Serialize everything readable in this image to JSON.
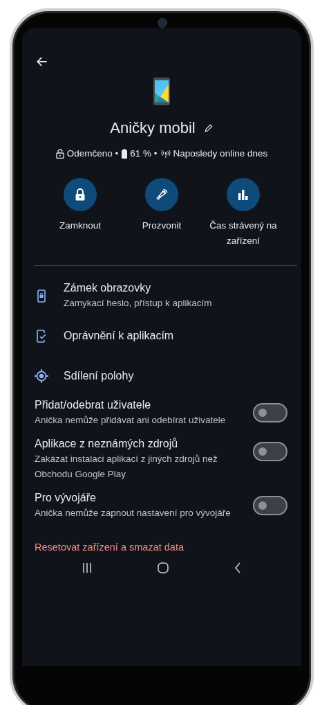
{
  "header": {
    "title": "Aničky mobil"
  },
  "status": [
    {
      "kind": "lock",
      "text": "Odemčeno •"
    },
    {
      "kind": "battery",
      "text": "61 % •"
    },
    {
      "kind": "signal",
      "text": "Naposledy online dnes"
    }
  ],
  "actions": [
    {
      "kind": "lock",
      "label": "Zamknout"
    },
    {
      "kind": "ring",
      "label": "Prozvonit"
    },
    {
      "kind": "chart",
      "label": "Čas strávený na zařízení"
    }
  ],
  "settings": [
    {
      "kind": "link",
      "title": "Zámek obrazovky",
      "subtitle": "Zamykací heslo, přístup k aplikacím"
    },
    {
      "kind": "link",
      "title": "Oprávnění k aplikacím"
    },
    {
      "kind": "link",
      "title": "Sdílení polohy"
    },
    {
      "kind": "toggle",
      "title": "Přidat/odebrat uživatele",
      "subtitle": "Anička nemůže přidávat ani odebírat uživatele",
      "on": false
    },
    {
      "kind": "toggle",
      "title": "Aplikace z neznámých zdrojů",
      "subtitle": "Zakázat instalaci aplikací z jiných zdrojů než Obchodu Google Play",
      "on": false
    },
    {
      "kind": "toggle",
      "title": "Pro vývojáře",
      "subtitle": "Anička nemůže zapnout nastavení pro vývojáře",
      "on": false
    }
  ],
  "reset": {
    "label": "Resetovat zařízení a smazat data"
  }
}
